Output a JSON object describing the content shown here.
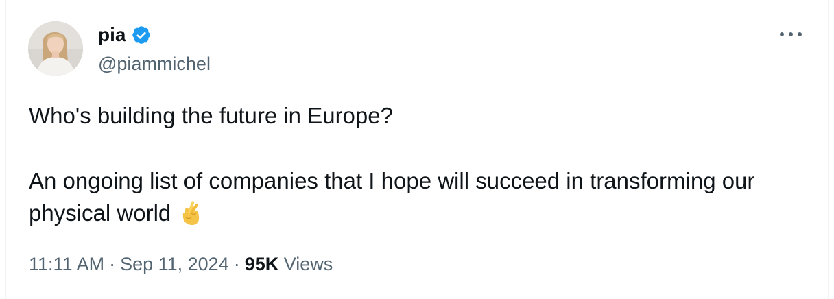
{
  "author": {
    "display_name": "pia",
    "handle": "@piammichel",
    "verified": true,
    "verified_color": "#1d9bf0"
  },
  "tweet": {
    "paragraph_1": "Who's building the future in Europe?",
    "paragraph_2": "An ongoing list of companies that I hope will succeed in transforming our physical world",
    "emoji": "crossed-fingers-emoji"
  },
  "meta": {
    "time": "11:11 AM",
    "separator": "·",
    "date": "Sep 11, 2024",
    "views_count": "95K",
    "views_label": "Views"
  },
  "icons": {
    "more": "more-options-icon",
    "verified": "verified-badge-icon"
  },
  "colors": {
    "text_primary": "#0f1419",
    "text_secondary": "#536471",
    "border": "#eff3f4",
    "accent": "#1d9bf0"
  }
}
